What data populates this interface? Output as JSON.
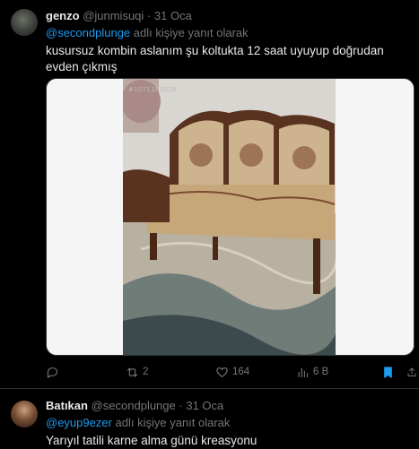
{
  "tweets": [
    {
      "display_name": "genzo",
      "handle": "@junmisuqi",
      "separator": "·",
      "date": "31 Oca",
      "reply_mention": "@secondplunge",
      "reply_suffix": " adlı kişiye yanıt olarak",
      "text": "kusursuz kombin aslanım şu koltukta 12 saat uyuyup doğrudan evden çıkmış",
      "media": {
        "watermark": "#1071182026",
        "description_alt": "Ornate wooden sofa with patterned upholstery"
      },
      "actions": {
        "reply_icon": "reply-icon",
        "retweet_icon": "retweet-icon",
        "retweet_count": "2",
        "like_icon": "heart-icon",
        "like_count": "164",
        "views_icon": "views-icon",
        "views_count": "6 B",
        "bookmark_icon": "bookmark-icon",
        "share_icon": "share-icon"
      }
    },
    {
      "display_name": "Batıkan",
      "handle": "@secondplunge",
      "separator": "·",
      "date": "31 Oca",
      "reply_mention": "@eyup9ezer",
      "reply_suffix": " adlı kişiye yanıt olarak",
      "text": "Yarıyıl tatili karne alma günü kreasyonu"
    }
  ],
  "colors": {
    "background": "#000000",
    "text_primary": "#e7e9ea",
    "text_secondary": "#71767b",
    "accent": "#1d9bf0",
    "divider": "#2f3336"
  }
}
